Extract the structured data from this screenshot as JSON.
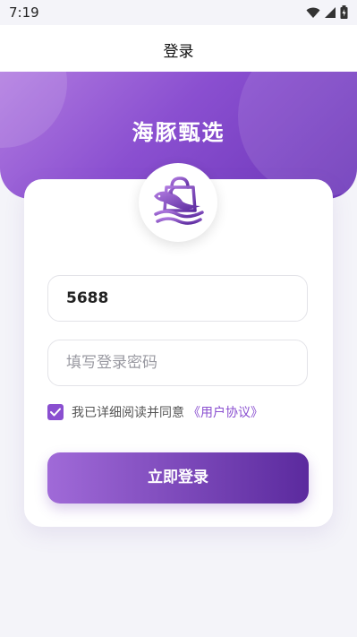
{
  "status_bar": {
    "time": "7:19"
  },
  "nav": {
    "title": "登录"
  },
  "hero": {
    "brand": "海豚甄选"
  },
  "form": {
    "username_value": "5688",
    "password_placeholder": "填写登录密码",
    "agree_text": "我已详细阅读并同意",
    "agree_link": "《用户协议》",
    "agree_checked": true,
    "login_label": "立即登录"
  },
  "colors": {
    "accent": "#8a4fd0",
    "accent_dark": "#5b2a9e",
    "background": "#f4f4f9"
  },
  "icons": [
    "wifi-icon",
    "signal-icon",
    "battery-icon",
    "dolphin-logo-icon",
    "check-icon"
  ]
}
